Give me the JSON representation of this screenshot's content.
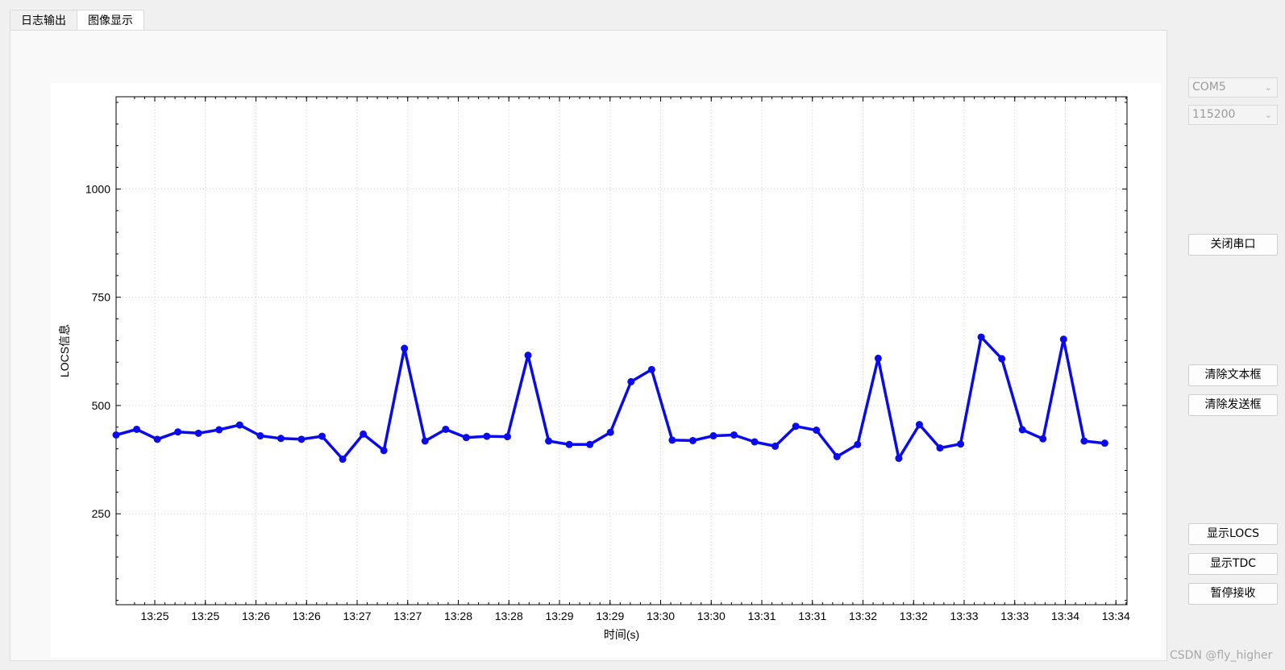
{
  "tabs": [
    {
      "label": "日志输出",
      "active": false
    },
    {
      "label": "图像显示",
      "active": true
    }
  ],
  "serial": {
    "port": "COM5",
    "baud": "115200"
  },
  "buttons": {
    "close_port": "关闭串口",
    "clear_text": "清除文本框",
    "clear_send": "清除发送框",
    "show_locs": "显示LOCS",
    "show_tdc": "显示TDC",
    "pause": "暂停接收"
  },
  "watermark": "CSDN @fly_higher",
  "chart_data": {
    "type": "line",
    "xlabel": "时间(s)",
    "ylabel": "LOCS信息",
    "ylim": [
      40,
      1213
    ],
    "yticks": [
      250,
      500,
      750,
      1000
    ],
    "x_tick_labels": [
      "13:25",
      "13:25",
      "13:26",
      "13:26",
      "13:27",
      "13:27",
      "13:28",
      "13:28",
      "13:29",
      "13:29",
      "13:30",
      "13:30",
      "13:31",
      "13:31",
      "13:32",
      "13:32",
      "13:33",
      "13:33",
      "13:34",
      "13:34"
    ],
    "grid": true,
    "color": "#0a0aee",
    "series": [
      {
        "values": [
          432,
          445,
          422,
          439,
          436,
          444,
          455,
          430,
          424,
          422,
          429,
          376,
          434,
          396,
          632,
          418,
          445,
          426,
          429,
          428,
          616,
          418,
          410,
          410,
          438,
          555,
          583,
          420,
          419,
          430,
          432,
          416,
          406,
          452,
          443,
          382,
          410,
          609,
          378,
          456,
          402,
          411,
          658,
          608,
          444,
          423,
          653,
          418,
          413
        ]
      }
    ]
  }
}
